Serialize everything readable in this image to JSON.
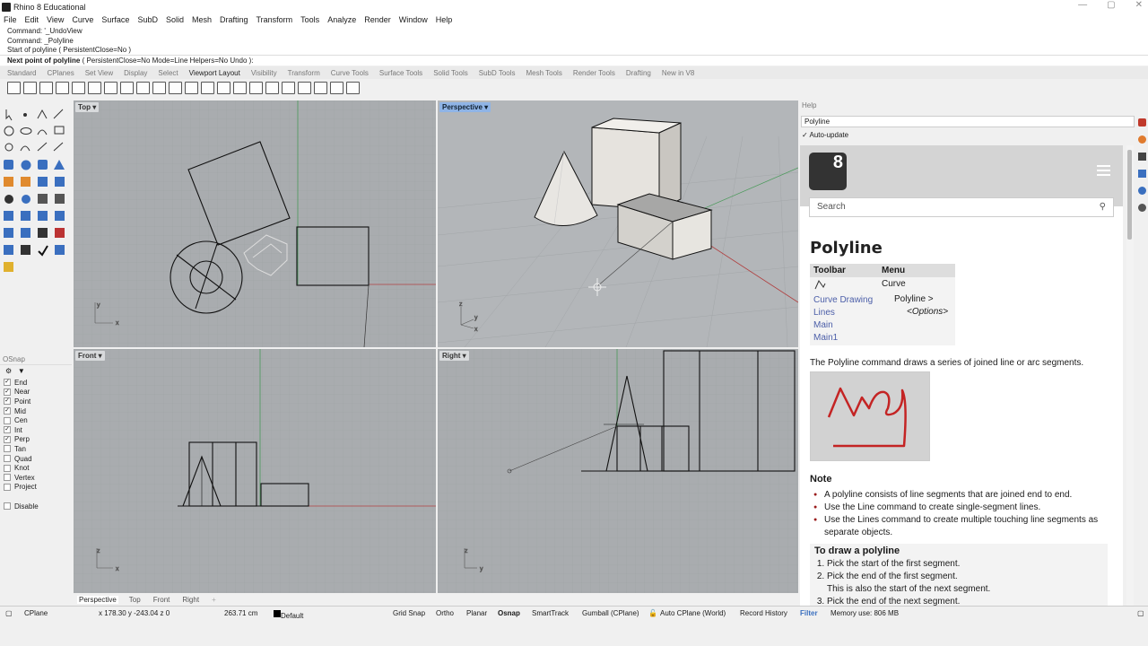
{
  "window": {
    "title": "Rhino 8 Educational"
  },
  "menu": [
    "File",
    "Edit",
    "View",
    "Curve",
    "Surface",
    "SubD",
    "Solid",
    "Mesh",
    "Drafting",
    "Transform",
    "Tools",
    "Analyze",
    "Render",
    "Window",
    "Help"
  ],
  "command_history": [
    "Command: '_UndoView",
    "Command: _Polyline",
    "Start of polyline ( PersistentClose=No )"
  ],
  "command_prompt": {
    "label": "Next point of polyline",
    "options": "( PersistentClose=No  Mode=Line  Helpers=No  Undo ):"
  },
  "toolbar_tabs": [
    "Standard",
    "CPlanes",
    "Set View",
    "Display",
    "Select",
    "Viewport Layout",
    "Visibility",
    "Transform",
    "Curve Tools",
    "Surface Tools",
    "Solid Tools",
    "SubD Tools",
    "Mesh Tools",
    "Render Tools",
    "Drafting",
    "New in V8"
  ],
  "active_toolbar_tab": "Viewport Layout",
  "osnap": {
    "title": "OSnap",
    "items": [
      {
        "label": "End",
        "checked": "✓"
      },
      {
        "label": "Near",
        "checked": "✓"
      },
      {
        "label": "Point",
        "checked": "✓"
      },
      {
        "label": "Mid",
        "checked": "✓"
      },
      {
        "label": "Cen",
        "checked": ""
      },
      {
        "label": "Int",
        "checked": "✓"
      },
      {
        "label": "Perp",
        "checked": "✓"
      },
      {
        "label": "Tan",
        "checked": ""
      },
      {
        "label": "Quad",
        "checked": ""
      },
      {
        "label": "Knot",
        "checked": ""
      },
      {
        "label": "Vertex",
        "checked": ""
      },
      {
        "label": "Project",
        "checked": ""
      }
    ],
    "disable_label": "Disable"
  },
  "viewports": {
    "top": "Top",
    "perspective": "Perspective",
    "front": "Front",
    "right": "Right"
  },
  "viewport_tabs": [
    "Perspective",
    "Top",
    "Front",
    "Right"
  ],
  "help": {
    "panel_title": "Help",
    "search_value": "Polyline",
    "auto_update": "Auto-update",
    "search_placeholder": "Search",
    "page_title": "Polyline",
    "table_headers": [
      "Toolbar",
      "Menu"
    ],
    "toolbar_links": [
      "Curve Drawing",
      "Lines",
      "Main",
      "Main1"
    ],
    "menu_path": [
      "Curve",
      "Polyline >",
      "<Options>"
    ],
    "description": "The Polyline command draws a series of joined line or arc segments.",
    "note_title": "Note",
    "notes": [
      "A polyline consists of line segments that are joined end to end.",
      "Use the Line command to create single-segment lines.",
      "Use the Lines command to create multiple touching line segments as separate objects."
    ],
    "steps_title": "To draw a polyline",
    "steps": [
      "Pick the start of the first segment.",
      "Pick the end of the first segment.",
      "This is also the start of the next segment.",
      "Pick the end of the next segment."
    ]
  },
  "status": {
    "cplane": "CPlane",
    "coords": "x 178.30  y -243.04  z 0",
    "distance": "263.71 cm",
    "layer": "Default",
    "toggles": [
      "Grid Snap",
      "Ortho",
      "Planar",
      "Osnap",
      "SmartTrack",
      "Gumball (CPlane)",
      "Auto CPlane (World)",
      "Record History",
      "Filter"
    ],
    "memory": "Memory use: 806 MB"
  },
  "colors": {
    "viewport_bg": "#a9acaf",
    "active_label": "#8fb4e6",
    "link": "#4b5ea8",
    "x_axis": "#c0392b",
    "y_axis": "#27ae60"
  }
}
